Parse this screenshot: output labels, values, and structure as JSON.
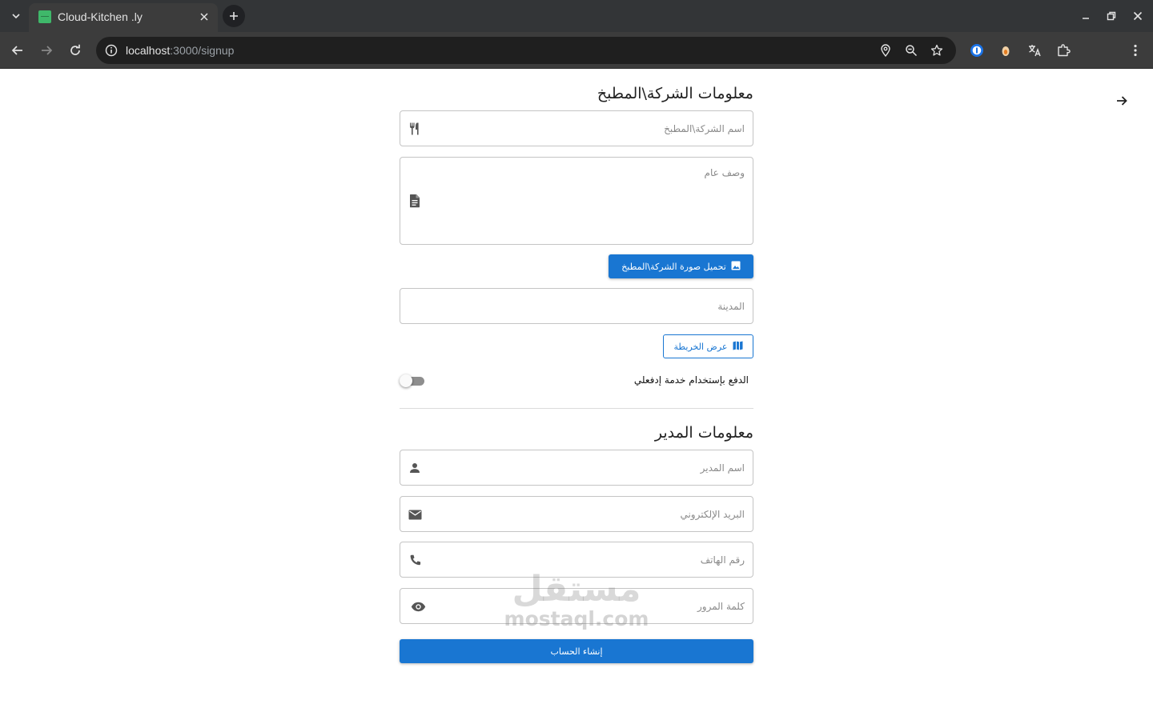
{
  "browser": {
    "tab_title": "Cloud-Kitchen .ly",
    "url_host": "localhost",
    "url_path": ":3000/signup"
  },
  "company_section": {
    "title": "معلومات الشركة\\المطبخ",
    "name_placeholder": "اسم الشركة\\المطبخ",
    "description_placeholder": "وصف عام",
    "upload_label": "تحميل صورة الشركة\\المطبخ",
    "city_placeholder": "المدينة",
    "map_label": "عرض الخريطة",
    "payment_switch_label": "الدفع بإستخدام خدمة إدفعلي",
    "payment_switch_on": false
  },
  "manager_section": {
    "title": "معلومات المدير",
    "name_placeholder": "اسم المدير",
    "email_placeholder": "البريد الإلكتروني",
    "phone_placeholder": "رقم الهاتف",
    "password_placeholder": "كلمة المرور"
  },
  "submit_label": "إنشاء الحساب",
  "watermark": {
    "arabic": "مستقل",
    "latin": "mostaql.com"
  },
  "colors": {
    "primary": "#1976d2",
    "chrome_dark": "#333537",
    "toolbar": "#3c3c3c"
  }
}
